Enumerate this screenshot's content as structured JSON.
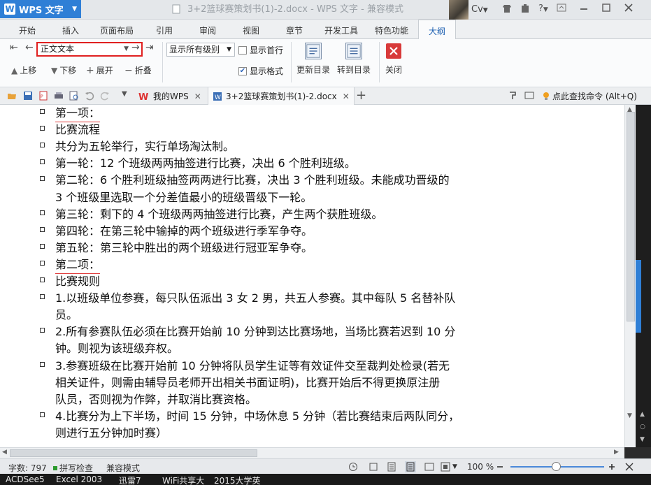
{
  "app": {
    "name": "WPS 文字",
    "window_title": "3+2篮球赛策划书(1)-2.docx - WPS 文字 - 兼容模式",
    "user_initials": "Cv",
    "help": "?"
  },
  "menu_tabs": [
    "开始",
    "插入",
    "页面布局",
    "引用",
    "审阅",
    "视图",
    "章节",
    "开发工具",
    "特色功能",
    "大纲"
  ],
  "ribbon": {
    "level_select": "正文文本",
    "show_level": "显示所有级别",
    "show_first_line": "显示首行",
    "show_format": "显示格式",
    "show_first_line_checked": false,
    "show_format_checked": true,
    "move_up": "上移",
    "move_down": "下移",
    "expand": "展开",
    "collapse": "折叠",
    "update_toc": "更新目录",
    "goto_toc": "转到目录",
    "close": "关闭"
  },
  "doc_tabs": [
    {
      "label": "我的WPS"
    },
    {
      "label": "3+2篮球赛策划书(1)-2.docx"
    }
  ],
  "search_hint": "点此查找命令 (Alt+Q)",
  "document_lines": [
    {
      "text": "第一项：",
      "bullet": true,
      "heading": true
    },
    {
      "text": "比赛流程",
      "bullet": true
    },
    {
      "text": "共分为五轮举行，实行单场淘汰制。",
      "bullet": true
    },
    {
      "text": "第一轮：12 个班级两两抽签进行比赛，决出 6 个胜利班级。",
      "bullet": true
    },
    {
      "text": "第二轮：6 个胜利班级抽签两两进行比赛，决出 3 个胜利班级。未能成功晋级的",
      "bullet": true
    },
    {
      "text": "3 个班级里选取一个分差值最小的班级晋级下一轮。",
      "bullet": false
    },
    {
      "text": "第三轮：剩下的 4 个班级两两抽签进行比赛，产生两个获胜班级。",
      "bullet": true
    },
    {
      "text": "第四轮：在第三轮中输掉的两个班级进行季军争夺。",
      "bullet": true
    },
    {
      "text": "第五轮：第三轮中胜出的两个班级进行冠亚军争夺。",
      "bullet": true
    },
    {
      "text": "第二项：",
      "bullet": true,
      "heading": true
    },
    {
      "text": "比赛规则",
      "bullet": true
    },
    {
      "text": "1.以班级单位参赛，每只队伍派出 3 女 2 男，共五人参赛。其中每队 5 名替补队",
      "bullet": true
    },
    {
      "text": "员。",
      "bullet": false
    },
    {
      "text": "2.所有参赛队伍必须在比赛开始前 10 分钟到达比赛场地，当场比赛若迟到 10 分",
      "bullet": true
    },
    {
      "text": "钟。则视为该班级弃权。",
      "bullet": false
    },
    {
      "text": "3.参赛班级在比赛开始前 10 分钟将队员学生证等有效证件交至裁判处检录(若无",
      "bullet": true
    },
    {
      "text": "相关证件，则需由辅导员老师开出相关书面证明)，比赛开始后不得更换原注册",
      "bullet": false
    },
    {
      "text": "队员，否则视为作弊，并取消比赛资格。",
      "bullet": false
    },
    {
      "text": "4.比赛分为上下半场，时间 15 分钟，中场休息 5 分钟（若比赛结束后两队同分，",
      "bullet": true
    },
    {
      "text": "则进行五分钟加时赛）",
      "bullet": false
    }
  ],
  "status": {
    "word_count": "字数: 797",
    "spell_check": "拼写检查",
    "compat_mode": "兼容模式",
    "zoom": "100 %",
    "zoom_level": 0.5
  },
  "taskbar": [
    "ACDSee5",
    "Excel 2003",
    "迅雷7",
    "WiFi共享大",
    "2015大学英"
  ],
  "colors": {
    "accent": "#2f7fd6",
    "highlight_border": "#e02020",
    "heading_underline": "#e03a3a"
  }
}
